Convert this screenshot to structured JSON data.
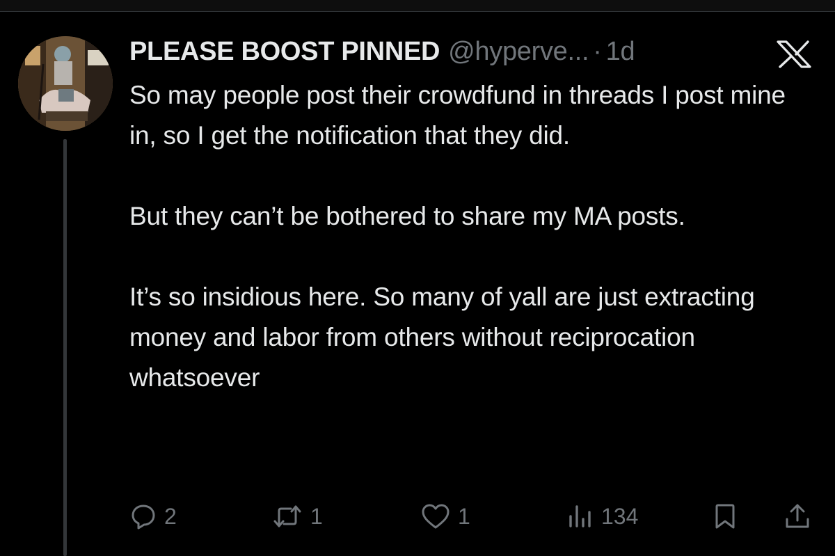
{
  "tweet": {
    "display_name": "PLEASE BOOST PINNED",
    "handle": "@hyperve...",
    "separator": "·",
    "time": "1d",
    "text_paragraphs": [
      "So may people post their crowdfund in threads I post mine in, so I get the notification that they did.",
      "But they can’t be bothered to share my MA posts.",
      "It’s so insidious here. So many of yall are just extracting money and labor from others without reciprocation whatsoever"
    ]
  },
  "actions": {
    "replies": "2",
    "reposts": "1",
    "likes": "1",
    "views": "134"
  },
  "icons": {
    "reply": "reply-bubble-icon",
    "repost": "repost-arrows-icon",
    "like": "heart-icon",
    "views": "analytics-bars-icon",
    "bookmark": "bookmark-icon",
    "share": "share-upload-icon",
    "brand": "x-logo-icon"
  },
  "colors": {
    "background": "#000000",
    "text": "#e7e9ea",
    "secondary": "#71767b"
  }
}
